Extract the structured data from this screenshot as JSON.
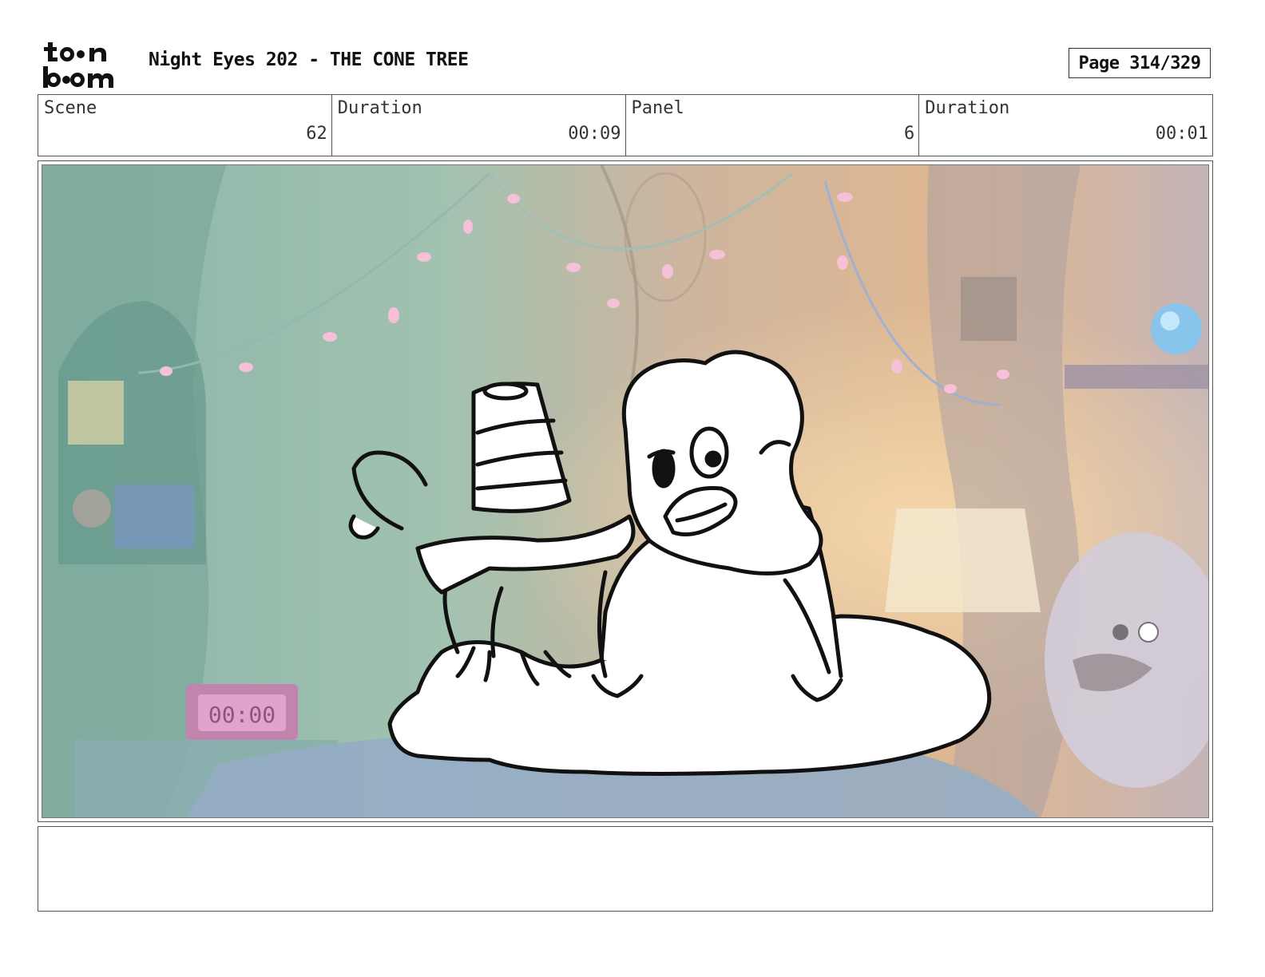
{
  "header": {
    "title": "Night Eyes 202 - THE CONE TREE",
    "page": "Page 314/329",
    "logo": "toon boom"
  },
  "info": [
    {
      "label": "Scene",
      "value": "62"
    },
    {
      "label": "Duration",
      "value": "00:09"
    },
    {
      "label": "Panel",
      "value": "6"
    },
    {
      "label": "Duration",
      "value": "00:01"
    }
  ],
  "panel": {
    "clock_text": "00:00"
  },
  "notes": {
    "text": ""
  }
}
